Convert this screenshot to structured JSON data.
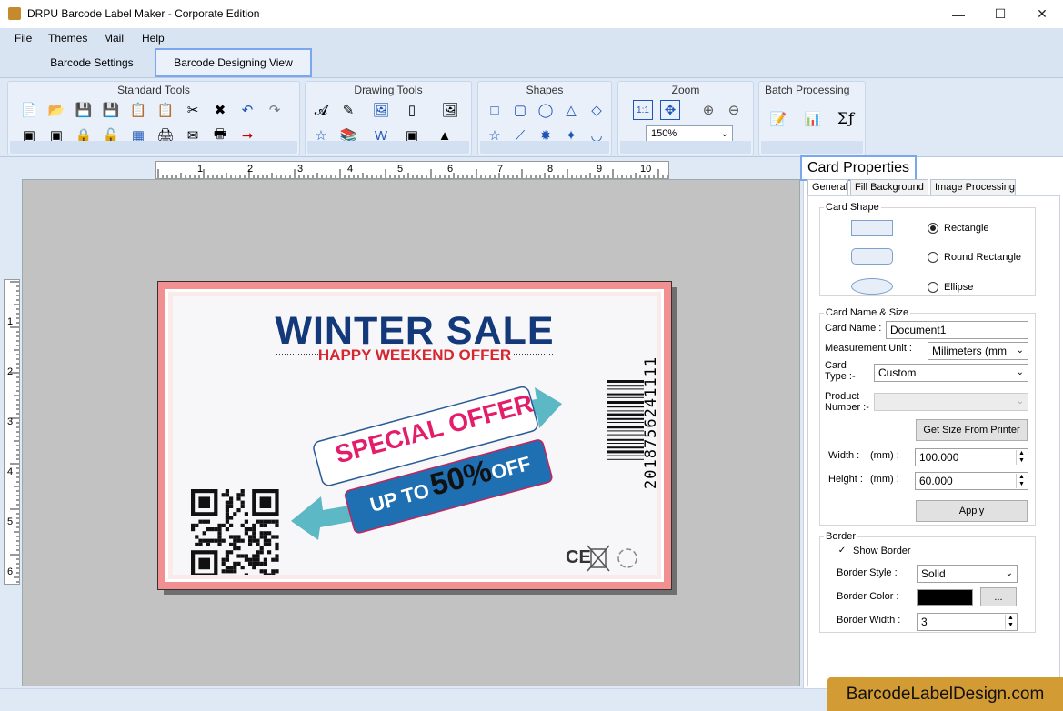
{
  "window": {
    "title": "DRPU Barcode Label Maker - Corporate Edition",
    "minimize_icon": "minimize-icon",
    "maximize_icon": "maximize-icon",
    "close_icon": "close-icon"
  },
  "menu": [
    "File",
    "Themes",
    "Mail",
    "Help"
  ],
  "ribbon_tabs": [
    "Barcode Settings",
    "Barcode Designing View"
  ],
  "toolbar_groups": {
    "standard": "Standard Tools",
    "drawing": "Drawing Tools",
    "shapes": "Shapes",
    "zoom": "Zoom",
    "batch": "Batch Processing"
  },
  "zoom": {
    "value": "150%"
  },
  "ruler": {
    "h_ticks": [
      "1",
      "2",
      "3",
      "4",
      "5",
      "6",
      "7",
      "8",
      "9",
      "10"
    ],
    "v_ticks": [
      "1",
      "2",
      "3",
      "4",
      "5",
      "6"
    ]
  },
  "label": {
    "title": "WINTER SALE",
    "subtitle": "HAPPY WEEKEND OFFER",
    "special": "SPECIAL OFFER",
    "upto": "UP TO",
    "percent": "50%",
    "off": "OFF",
    "barcode_number": "2018756241111",
    "ce_mark": "CE",
    "colors": {
      "title": "#13397a",
      "subtitle": "#d6262f",
      "special": "#e41d6a",
      "offer_bg": "#1f6fb3",
      "border": "#f29091"
    }
  },
  "panel": {
    "title": "Card Properties",
    "tabs": [
      "General",
      "Fill Background",
      "Image Processing"
    ],
    "card_shape": {
      "legend": "Card Shape",
      "options": [
        "Rectangle",
        "Round Rectangle",
        "Ellipse"
      ],
      "selected": "Rectangle"
    },
    "card_name_size": {
      "legend": "Card  Name & Size",
      "card_name_label": "Card Name :",
      "card_name_value": "Document1",
      "measurement_label": "Measurement Unit :",
      "measurement_value": "Milimeters (mm",
      "card_type_label": "Card\nType :-",
      "card_type_value": "Custom",
      "product_label": "Product\nNumber :-",
      "get_size_button": "Get Size From Printer",
      "width_label": "Width :",
      "width_unit": "(mm) :",
      "width_value": "100.000",
      "height_label": "Height :",
      "height_unit": "(mm) :",
      "height_value": "60.000",
      "apply_button": "Apply"
    },
    "border": {
      "legend": "Border",
      "show_border_label": "Show Border",
      "show_border_checked": true,
      "style_label": "Border Style :",
      "style_value": "Solid",
      "color_label": "Border Color :",
      "color_value": "#000000",
      "color_button": "...",
      "width_label": "Border Width :",
      "width_value": "3"
    }
  },
  "brand": "BarcodeLabelDesign.com"
}
